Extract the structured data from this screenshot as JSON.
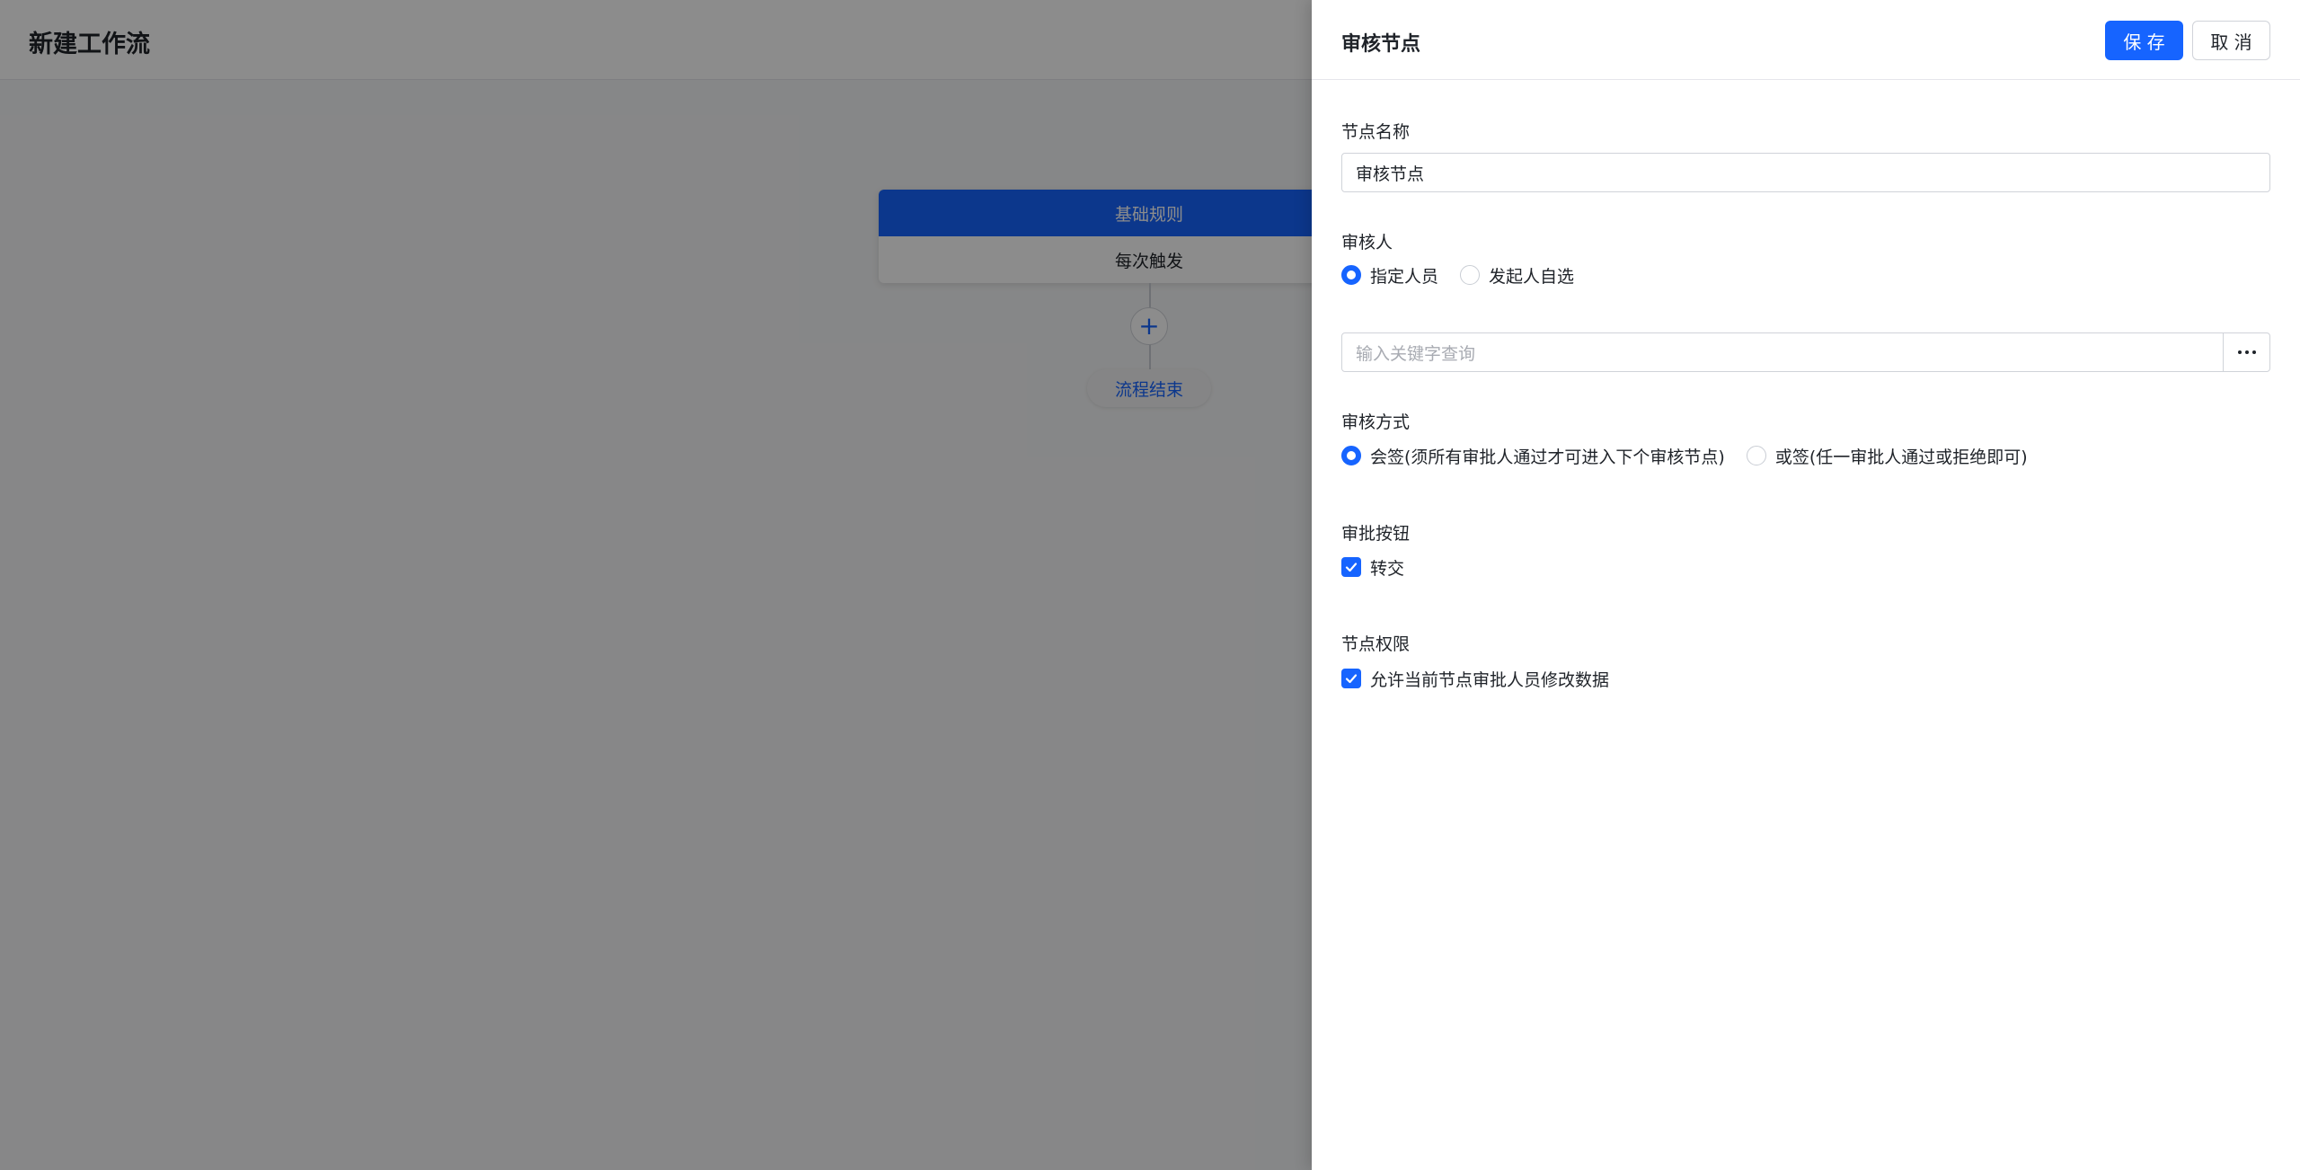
{
  "app": {
    "title": "新建工作流"
  },
  "flow": {
    "node_header": "基础规则",
    "node_body": "每次触发",
    "add_symbol": "+",
    "end_label": "流程结束"
  },
  "drawer": {
    "title": "审核节点",
    "save_label": "保 存",
    "cancel_label": "取 消",
    "node_name": {
      "label": "节点名称",
      "value": "审核节点"
    },
    "reviewer": {
      "label": "审核人",
      "options": [
        {
          "label": "指定人员",
          "checked": true
        },
        {
          "label": "发起人自选",
          "checked": false
        }
      ],
      "search_placeholder": "输入关键字查询"
    },
    "review_mode": {
      "label": "审核方式",
      "options": [
        {
          "label": "会签(须所有审批人通过才可进入下个审核节点)",
          "checked": true
        },
        {
          "label": "或签(任一审批人通过或拒绝即可)",
          "checked": false
        }
      ]
    },
    "approve_buttons": {
      "label": "审批按钮",
      "options": [
        {
          "label": "转交",
          "checked": true
        }
      ]
    },
    "node_permission": {
      "label": "节点权限",
      "options": [
        {
          "label": "允许当前节点审批人员修改数据",
          "checked": true
        }
      ]
    }
  },
  "colors": {
    "primary": "#1664ff",
    "mask": "rgba(0,0,0,0.45)"
  }
}
